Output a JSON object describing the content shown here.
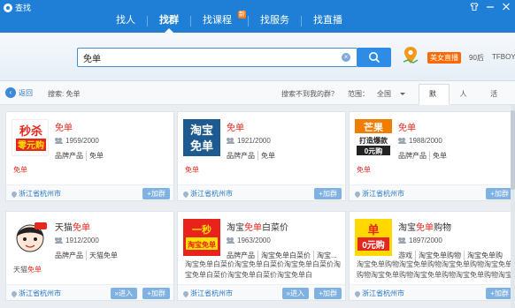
{
  "window": {
    "title": "查找"
  },
  "nav": {
    "items": [
      {
        "label": "找人"
      },
      {
        "label": "找群"
      },
      {
        "label": "找课程",
        "badge": "新"
      },
      {
        "label": "找服务"
      },
      {
        "label": "找直播"
      }
    ]
  },
  "search": {
    "value": "免单",
    "promo": {
      "live_badge": "美女直播",
      "tag1": "90后",
      "tag2": "TFBOYS"
    }
  },
  "filter": {
    "back_label": "返回",
    "search_label": "搜索: 免单",
    "not_found": "搜索不到我的群？",
    "range_label": "范围：",
    "range_value": "全国",
    "sort_tabs": [
      "默认",
      "人数",
      "活跃度"
    ]
  },
  "cards": [
    {
      "name_hl": "免单",
      "name_rest": "",
      "members": "1959/2000",
      "tags": [
        "品牌产品",
        "免单"
      ],
      "desc": "免单",
      "location": "浙江省杭州市",
      "join_label": "+加群",
      "avatar": {
        "line1": "秒杀",
        "line2": "零元购",
        "bg": "#ffffff"
      }
    },
    {
      "name_hl": "免单",
      "name_rest": "",
      "members": "1921/2000",
      "tags": [
        "品牌产品",
        "免单"
      ],
      "desc": "免单",
      "location": "浙江省杭州市",
      "join_label": "+加群",
      "avatar": {
        "line1": "淘宝",
        "line2": "免单",
        "bg": "#1c5a8f"
      }
    },
    {
      "name_hl": "免单",
      "name_rest": "",
      "members": "1988/2000",
      "tags": [
        "品牌产品",
        "免单"
      ],
      "desc": "免单",
      "location": "浙江省杭州市",
      "join_label": "+加群",
      "avatar": {
        "line1": "芒果",
        "line2": "打造爆款",
        "line3": "0元购",
        "bg": "#ffffff"
      }
    },
    {
      "name_pre": "天猫",
      "name_hl": "免单",
      "members": "1912/2000",
      "tags": [
        "品牌产品",
        "天猫免单"
      ],
      "desc_pre": "天猫",
      "desc_hl": "免单",
      "location": "浙江省杭州市",
      "enter_label": "»进入",
      "join_label": "+加群",
      "avatar": {
        "bg": "#ffffff"
      }
    },
    {
      "name_pre": "淘宝",
      "name_hl": "免单",
      "name_rest": "白菜价",
      "members": "1963/2000",
      "tags": [
        "品牌产品",
        "淘宝免单白菜价",
        "淘宝..."
      ],
      "desc": "淘宝免单白菜价淘宝免单白菜价淘宝免单白菜价淘宝免单白菜价淘宝免单白菜价淘宝免单白",
      "location": "浙江省杭州市",
      "enter_label": "»进入",
      "join_label": "+加群",
      "avatar": {
        "line1": "一秒",
        "line2": "淘宝免单",
        "bg": "#e8231b"
      }
    },
    {
      "name_pre": "淘宝",
      "name_hl": "免单",
      "name_rest": "购物",
      "members": "1897/2000",
      "tags": [
        "游戏",
        "淘宝免单购物",
        "淘宝免单购"
      ],
      "desc": "淘宝免单购物淘宝免单购物淘宝免单购物淘宝免单购物淘宝免单购物淘宝免单购物淘宝免单购物淘宝免单购物",
      "location": "浙江省杭州市",
      "enter_label": "»进入",
      "join_label": "+加群",
      "avatar": {
        "line1": "单",
        "line2": "0元购",
        "bg": "#ffd800"
      }
    }
  ]
}
